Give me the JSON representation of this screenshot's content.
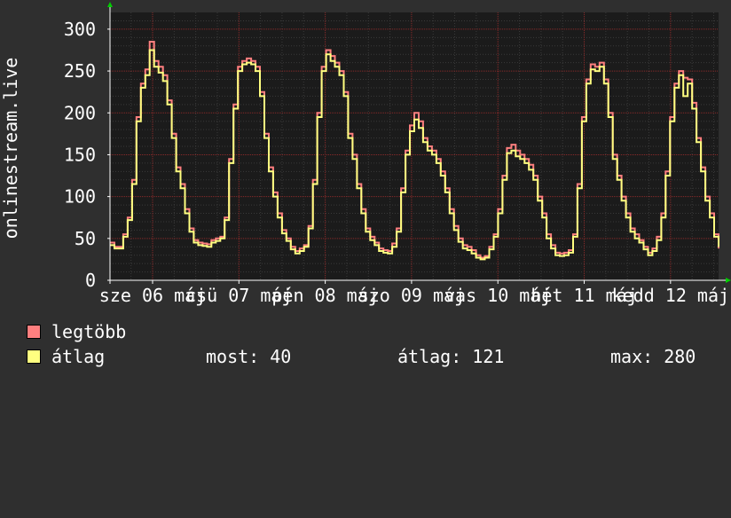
{
  "chart_data": {
    "type": "area",
    "ylabel": "onlinestream.live",
    "ylim": [
      0,
      320
    ],
    "yticks": [
      0,
      50,
      100,
      150,
      200,
      250,
      300
    ],
    "x_tick_labels": [
      "sze 06 máj",
      "csü 07 máj",
      "pén 08 máj",
      "szo 09 máj",
      "vas 10 máj",
      "hét 11 máj",
      "kedd 12 máj"
    ],
    "grid": true,
    "series": [
      {
        "name": "legtöbb",
        "color": "#ff7f7f",
        "values": [
          45,
          40,
          40,
          55,
          75,
          120,
          195,
          235,
          252,
          285,
          262,
          255,
          245,
          215,
          175,
          135,
          115,
          85,
          62,
          48,
          45,
          44,
          43,
          48,
          50,
          52,
          75,
          145,
          210,
          255,
          262,
          265,
          262,
          255,
          225,
          175,
          135,
          105,
          80,
          60,
          50,
          40,
          35,
          38,
          42,
          65,
          120,
          200,
          255,
          275,
          268,
          260,
          250,
          225,
          175,
          150,
          115,
          85,
          62,
          52,
          45,
          38,
          36,
          35,
          44,
          62,
          110,
          155,
          185,
          200,
          190,
          170,
          160,
          155,
          145,
          130,
          110,
          85,
          65,
          50,
          42,
          40,
          36,
          30,
          27,
          29,
          40,
          55,
          85,
          125,
          158,
          162,
          155,
          150,
          145,
          138,
          125,
          100,
          80,
          55,
          42,
          33,
          32,
          33,
          36,
          55,
          115,
          195,
          240,
          258,
          255,
          260,
          240,
          200,
          150,
          125,
          100,
          80,
          62,
          55,
          48,
          40,
          33,
          38,
          52,
          80,
          130,
          195,
          235,
          250,
          242,
          240,
          212,
          170,
          135,
          100,
          80,
          55,
          38
        ]
      },
      {
        "name": "átlag",
        "color": "#ffff80",
        "values": [
          42,
          38,
          38,
          52,
          72,
          115,
          190,
          230,
          245,
          275,
          255,
          248,
          238,
          210,
          170,
          130,
          110,
          80,
          58,
          45,
          42,
          41,
          40,
          45,
          47,
          50,
          72,
          140,
          205,
          250,
          258,
          260,
          258,
          250,
          220,
          170,
          130,
          100,
          75,
          56,
          47,
          37,
          32,
          35,
          40,
          62,
          115,
          195,
          250,
          270,
          262,
          255,
          245,
          220,
          170,
          145,
          110,
          80,
          58,
          48,
          42,
          35,
          33,
          32,
          40,
          58,
          105,
          150,
          178,
          192,
          182,
          165,
          155,
          150,
          140,
          125,
          105,
          80,
          60,
          46,
          38,
          36,
          32,
          27,
          25,
          27,
          37,
          52,
          80,
          120,
          152,
          155,
          148,
          145,
          140,
          132,
          120,
          95,
          75,
          50,
          38,
          30,
          29,
          30,
          33,
          52,
          110,
          190,
          235,
          252,
          250,
          255,
          235,
          195,
          145,
          120,
          95,
          75,
          58,
          50,
          45,
          37,
          30,
          35,
          48,
          75,
          125,
          190,
          230,
          245,
          220,
          235,
          205,
          165,
          130,
          95,
          75,
          52,
          40
        ]
      }
    ],
    "legend_placement": "bottom-left"
  },
  "legend": {
    "items": [
      {
        "label": "legtöbb",
        "color": "#ff7f7f"
      },
      {
        "label": "átlag",
        "color": "#ffff80"
      }
    ],
    "stats": {
      "now": "most: 40",
      "avg": "átlag: 121",
      "max": "max: 280"
    }
  },
  "colors": {
    "background": "#2f2f2f",
    "plot_background": "#1b1b1b",
    "grid_minor": "#3a3a3a",
    "grid_major": "#8a2a2a",
    "axis": "#ffffff",
    "arrow": "#00cc00"
  }
}
